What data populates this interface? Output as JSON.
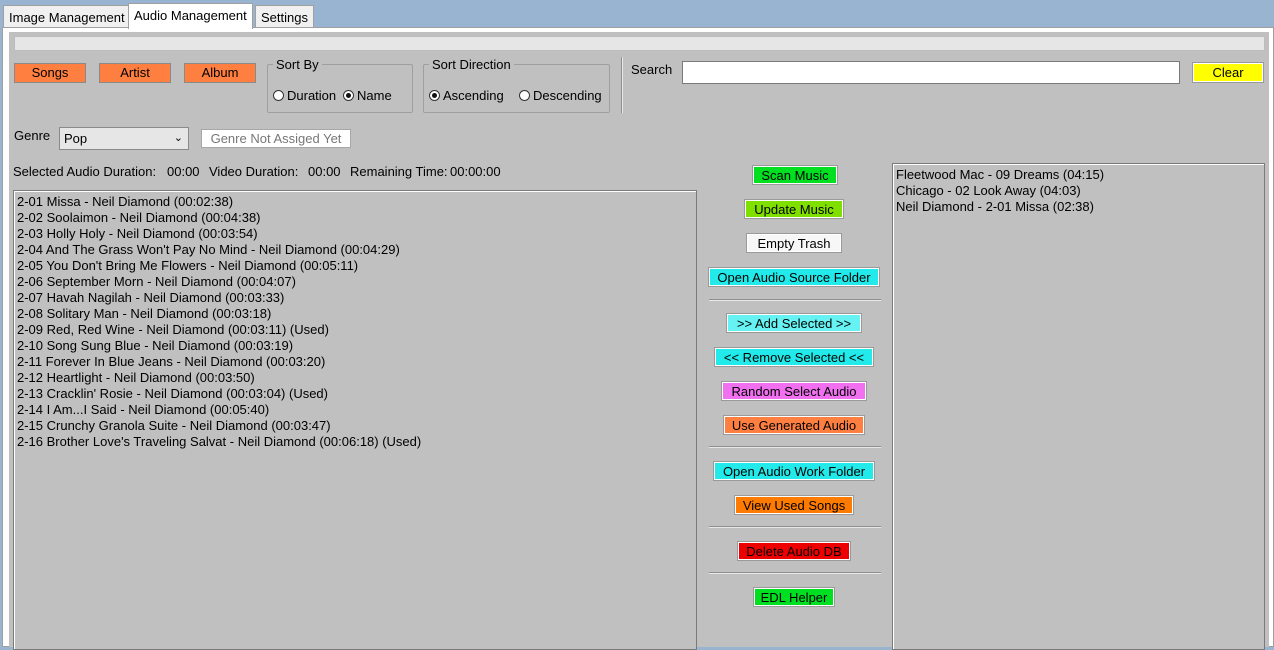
{
  "tabs": [
    {
      "label": "Image Management",
      "active": false
    },
    {
      "label": "Audio Management",
      "active": true
    },
    {
      "label": "Settings",
      "active": false
    }
  ],
  "toolbar": {
    "songs_label": "Songs",
    "artist_label": "Artist",
    "album_label": "Album",
    "clear_label": "Clear"
  },
  "sort_by": {
    "legend": "Sort By",
    "duration_label": "Duration",
    "name_label": "Name",
    "selected": "Name"
  },
  "sort_direction": {
    "legend": "Sort Direction",
    "ascending_label": "Ascending",
    "descending_label": "Descending",
    "selected": "Ascending"
  },
  "search": {
    "label": "Search",
    "value": ""
  },
  "genre": {
    "label": "Genre",
    "selected": "Pop",
    "not_assigned_label": "Genre Not Assiged Yet"
  },
  "status": {
    "selected_audio_duration_label": "Selected Audio Duration:",
    "selected_audio_duration_value": "00:00",
    "video_duration_label": "Video Duration:",
    "video_duration_value": "00:00",
    "remaining_time_label": "Remaining Time:",
    "remaining_time_value": "00:00:00"
  },
  "song_list": [
    "2-01 Missa - Neil Diamond (00:02:38)",
    "2-02 Soolaimon - Neil Diamond (00:04:38)",
    "2-03 Holly Holy - Neil Diamond (00:03:54)",
    "2-04 And The Grass Won't Pay No Mind - Neil Diamond (00:04:29)",
    "2-05 You Don't Bring Me Flowers - Neil Diamond (00:05:11)",
    "2-06 September Morn - Neil Diamond (00:04:07)",
    "2-07 Havah Nagilah - Neil Diamond (00:03:33)",
    "2-08 Solitary Man - Neil Diamond (00:03:18)",
    "2-09 Red, Red Wine - Neil Diamond (00:03:11) (Used)",
    "2-10 Song Sung Blue - Neil Diamond (00:03:19)",
    "2-11 Forever In Blue Jeans - Neil Diamond (00:03:20)",
    "2-12 Heartlight - Neil Diamond (00:03:50)",
    "2-13 Cracklin' Rosie - Neil Diamond (00:03:04) (Used)",
    "2-14 I Am...I Said - Neil Diamond (00:05:40)",
    "2-15 Crunchy Granola Suite - Neil Diamond (00:03:47)",
    "2-16 Brother Love's Traveling Salvat - Neil Diamond (00:06:18) (Used)"
  ],
  "selected_list": [
    "Fleetwood Mac - 09 Dreams (04:15)",
    "Chicago - 02 Look Away (04:03)",
    "Neil Diamond - 2-01 Missa (02:38)"
  ],
  "actions": {
    "scan_music": "Scan Music",
    "update_music": "Update Music",
    "empty_trash": "Empty Trash",
    "open_audio_source_folder": "Open Audio Source Folder",
    "add_selected": ">> Add Selected >>",
    "remove_selected": "<< Remove Selected <<",
    "random_select_audio": "Random Select Audio",
    "use_generated_audio": "Use Generated Audio",
    "open_audio_work_folder": "Open Audio Work Folder",
    "view_used_songs": "View Used Songs",
    "delete_audio_db": "Delete Audio DB",
    "edl_helper": "EDL Helper"
  },
  "colors": {
    "orange": "#ff7f40",
    "yellow": "#ffff00",
    "green_bright": "#00e020",
    "green_lime": "#7fe000",
    "cyan": "#22eaea",
    "cyan_light": "#66f2f2",
    "violet": "#f070f0",
    "orange_dark": "#ff7b00",
    "red": "#ee0000",
    "panel_gray": "#c0c0c0",
    "window_blue": "#99b4d1"
  }
}
